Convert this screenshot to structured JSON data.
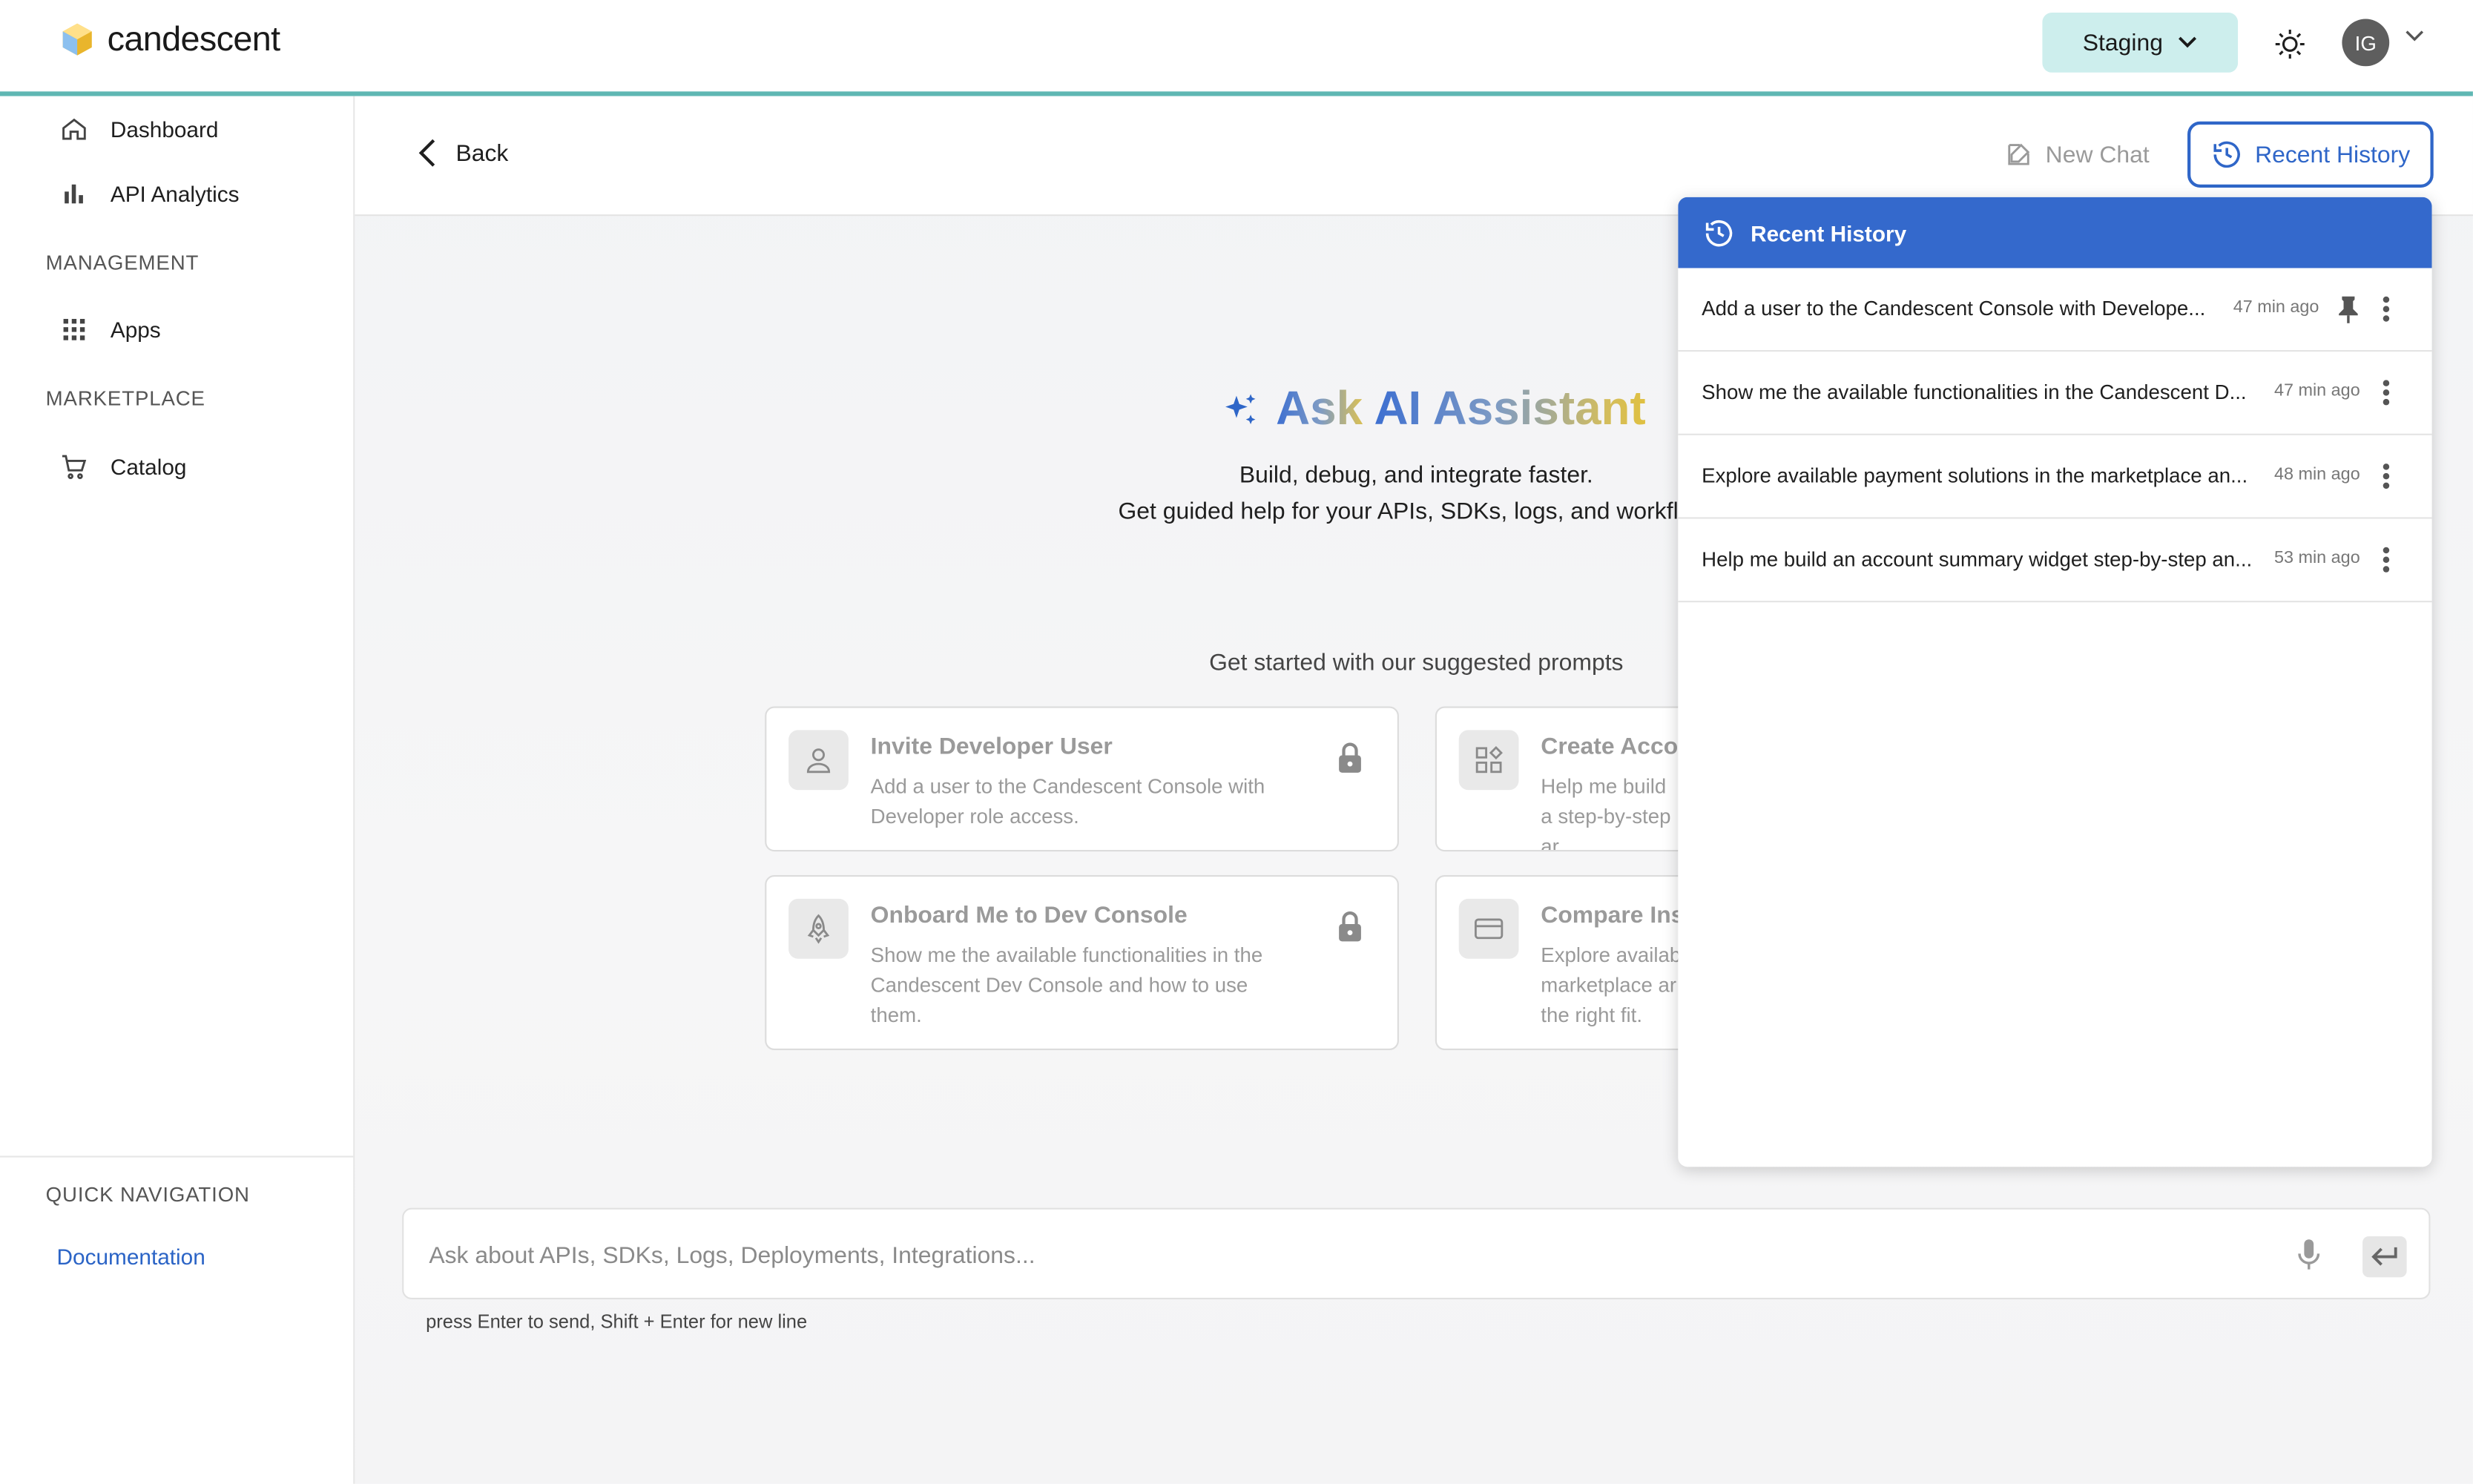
{
  "header": {
    "brand": "candescent",
    "environment": "Staging",
    "avatar_initials": "IG"
  },
  "sidebar": {
    "items": [
      {
        "label": "Dashboard",
        "icon": "home-icon"
      },
      {
        "label": "API Analytics",
        "icon": "bar-chart-icon"
      }
    ],
    "management_label": "MANAGEMENT",
    "management_items": [
      {
        "label": "Apps",
        "icon": "grid-icon"
      }
    ],
    "marketplace_label": "MARKETPLACE",
    "marketplace_items": [
      {
        "label": "Catalog",
        "icon": "cart-icon"
      }
    ],
    "quick_nav_label": "QUICK NAVIGATION",
    "quick_nav_link": "Documentation"
  },
  "toolbar": {
    "back_label": "Back",
    "new_chat_label": "New Chat",
    "recent_history_label": "Recent History"
  },
  "hero": {
    "title_prefix": "Ask ",
    "title_highlight": "AI Assistant",
    "subtitle1": "Build, debug, and integrate faster.",
    "subtitle2": "Get guided help for your APIs, SDKs, logs, and workflo",
    "suggest_label": "Get started with our suggested prompts"
  },
  "prompts": [
    {
      "title": "Invite Developer User",
      "description": "Add a user to the Candescent Console with Developer role access.",
      "icon": "user-icon",
      "locked": true
    },
    {
      "title": "Create Acco",
      "description": "Help me build a step-by-step ar",
      "icon": "widgets-icon",
      "locked": false
    },
    {
      "title": "Onboard Me to Dev Console",
      "description": "Show me the available functionalities in the Candescent Dev Console and how to use them.",
      "icon": "rocket-icon",
      "locked": true
    },
    {
      "title": "Compare Ins",
      "description": "Explore availab marketplace ar the right fit.",
      "icon": "card-icon",
      "locked": false
    }
  ],
  "composer": {
    "placeholder": "Ask about APIs, SDKs, Logs, Deployments, Integrations...",
    "hint": "press Enter to send, Shift + Enter for new line"
  },
  "history": {
    "title": "Recent History",
    "items": [
      {
        "text": "Add a user to the Candescent Console with Develope...",
        "time": "47 min ago",
        "pinned": true
      },
      {
        "text": "Show me the available functionalities in the Candescent D...",
        "time": "47 min ago",
        "pinned": false
      },
      {
        "text": "Explore available payment solutions in the marketplace an...",
        "time": "48 min ago",
        "pinned": false
      },
      {
        "text": "Help me build an account summary widget step-by-step an...",
        "time": "53 min ago",
        "pinned": false
      }
    ]
  },
  "colors": {
    "accent": "#2f66c8",
    "panel_header": "#3469cc",
    "header_border": "#5fb7b3",
    "env_button": "#cdeeed"
  }
}
